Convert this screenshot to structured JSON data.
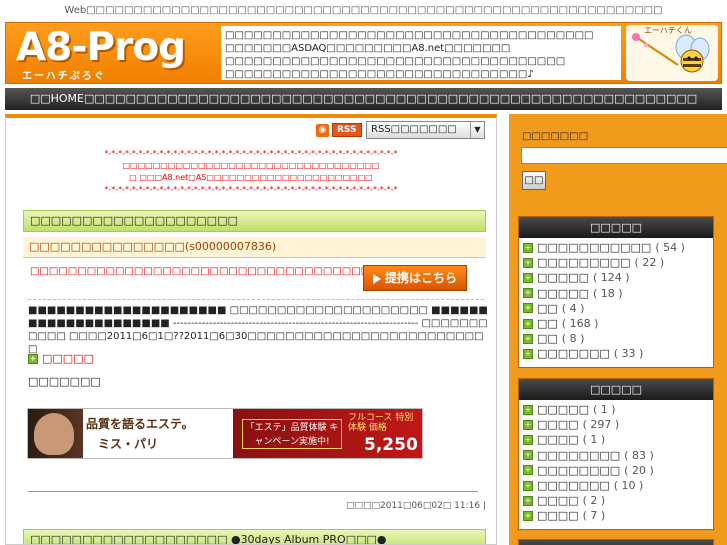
{
  "top_line": "Web□□□□□□□□□□□□□□□□□□□□□□□□□□□□□□□□□□□□□□□□□□□□□□□□□□□□□□□□□□□□□",
  "header": {
    "logo_text": "A8-Prog",
    "logo_sub": "エーハチぷろぐ",
    "description": "□□□□□□□□□□□□□□□□□□□□□□□□□□□□□□□□□□□□□□□ □□□□□□□ASDAQ□□□□□□□□□A8.net□□□□□□□ □□□□□□□□□□□□□□□□□□□□□□□□□□□□□□□□□□□□ □□□□□□□□□□□□□□□□□□□□□□□□□□□□□□□□♪",
    "mascot_label": "エーハチくん"
  },
  "nav": {
    "text": "□□HOME□□□□□□□□□□□□□□□□□□□□□□□□□□□□□□□□□□□□□□□□□□□□□□□□□□□□□□□□□□□"
  },
  "rss": {
    "icon_name": "rss-feed-icon",
    "badge": "RSS",
    "select_value": "RSS□□□□□□□"
  },
  "notice": {
    "line1": "*-*-*-*-*-*-*-*-*-*-*-*-*-*-*-*-*-*-*-*-*-*-*-*-*-*-*-*-*-*-*-*-*-*-*-*-*-*-*-*-*-*-*",
    "line2": "□□□□□□□□□□□□□□□□□□□□□□□□□□□□□□□□□□",
    "line3": "□ □□□A8.net□AS□□□□□□□□□□□□□□□□□□□□□□",
    "line4": "*-*-*-*-*-*-*-*-*-*-*-*-*-*-*-*-*-*-*-*-*-*-*-*-*-*-*-*-*-*-*-*-*-*-*-*-*-*-*-*-*-*-*"
  },
  "post": {
    "title": "□□□□□□□□□□□□□□□□□□□□",
    "program": "□□□□□□□□□□□□□□□(s00000007836)",
    "teaser": "□□□□□□□□□□□□□□□□□□□□□□□□□□□□□□□□□□□□",
    "cta_label": "提携はこちら",
    "body": "■■■■■■■■■■■■■■■■■■■■■ □□□□□□□□□□□□□□□□□□□□□ ■■■■■■■■■■■■■■■■■■■■■ -------------------------------------------------------------------- □□□□□□□□□□□ □□□□2011□6□1□??2011□6□30□□□□□□□□□□□□□□□□□□□□□□□□□□",
    "more_label": "□□□□□",
    "small_text": "□□□□□□□",
    "banner": {
      "text1": "品質を語るエステ。",
      "text2": "ミス・パリ",
      "campaign": "「エステ」品質体験 キャンペーン実施中!",
      "price_label": "フルコース 特別 体験 価格",
      "price": "5,250円"
    },
    "meta": "□□□□2011□06□02□ 11:16 |"
  },
  "post2": {
    "title": "□□□□□□□□□□□□□□□□□□□ ●30days Album PRO□□□●"
  },
  "sidebar": {
    "search_label": "□□□□□□□",
    "search_button": "□□",
    "box1": {
      "title": "□□□□□",
      "items": [
        {
          "label": "□□□□□□□□□□□",
          "count": "( 54 )"
        },
        {
          "label": "□□□□□□□□□",
          "count": "( 22 )"
        },
        {
          "label": "□□□□□",
          "count": "( 124 )"
        },
        {
          "label": "□□□□□",
          "count": "( 18 )"
        },
        {
          "label": "□□",
          "count": "( 4 )"
        },
        {
          "label": "□□",
          "count": "( 168 )"
        },
        {
          "label": "□□",
          "count": "( 8 )"
        },
        {
          "label": "□□□□□□□",
          "count": "( 33 )"
        }
      ]
    },
    "box2": {
      "title": "□□□□□",
      "items": [
        {
          "label": "□□□□□",
          "count": "( 1 )"
        },
        {
          "label": "□□□□",
          "count": "( 297 )"
        },
        {
          "label": "□□□□",
          "count": "( 1 )"
        },
        {
          "label": "□□□□□□□□",
          "count": "( 83 )"
        },
        {
          "label": "□□□□□□□□",
          "count": "( 20 )"
        },
        {
          "label": "□□□□□□□",
          "count": "( 10 )"
        },
        {
          "label": "□□□□",
          "count": "( 2 )"
        },
        {
          "label": "□□□□",
          "count": "( 7 )"
        }
      ]
    },
    "box3": {
      "title": "□□□□□"
    }
  }
}
